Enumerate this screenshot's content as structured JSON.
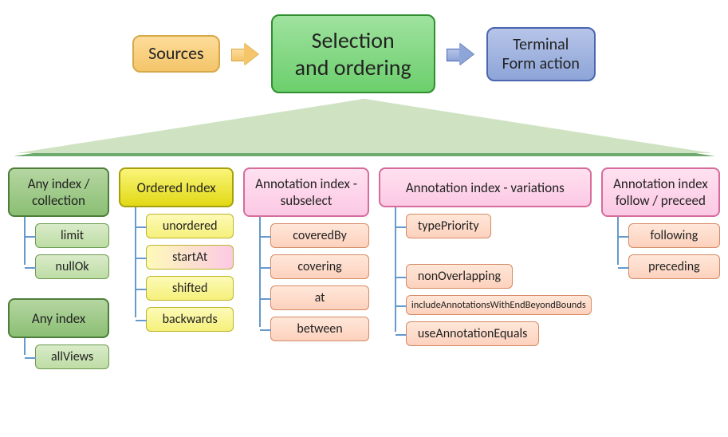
{
  "top": {
    "sources": "Sources",
    "selection_l1": "Selection",
    "selection_l2": "and ordering",
    "terminal_l1": "Terminal",
    "terminal_l2": "Form action"
  },
  "cols": {
    "anyIndexCollection": {
      "title": "Any index / collection",
      "items": [
        "limit",
        "nullOk"
      ]
    },
    "anyIndex": {
      "title": "Any index",
      "items": [
        "allViews"
      ]
    },
    "orderedIndex": {
      "title": "Ordered Index",
      "items": [
        "unordered",
        "startAt",
        "shifted",
        "backwards"
      ]
    },
    "subselect": {
      "title": "Annotation index - subselect",
      "items": [
        "coveredBy",
        "covering",
        "at",
        "between"
      ]
    },
    "variations": {
      "title": "Annotation index - variations",
      "items": [
        "typePriority",
        "nonOverlapping",
        "includeAnnotationsWithEndBeyondBounds",
        "useAnnotationEquals"
      ]
    },
    "followPreceed": {
      "title": "Annotation index follow / preceed",
      "items": [
        "following",
        "preceding"
      ]
    }
  }
}
